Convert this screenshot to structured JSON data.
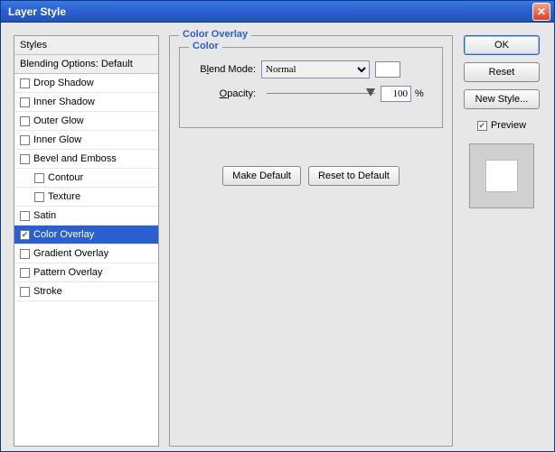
{
  "window": {
    "title": "Layer Style"
  },
  "sidebar": {
    "heading": "Styles",
    "blending": "Blending Options: Default",
    "items": [
      {
        "label": "Drop Shadow",
        "checked": false
      },
      {
        "label": "Inner Shadow",
        "checked": false
      },
      {
        "label": "Outer Glow",
        "checked": false
      },
      {
        "label": "Inner Glow",
        "checked": false
      },
      {
        "label": "Bevel and Emboss",
        "checked": false
      },
      {
        "label": "Contour",
        "checked": false,
        "sub": true
      },
      {
        "label": "Texture",
        "checked": false,
        "sub": true
      },
      {
        "label": "Satin",
        "checked": false
      },
      {
        "label": "Color Overlay",
        "checked": true,
        "active": true
      },
      {
        "label": "Gradient Overlay",
        "checked": false
      },
      {
        "label": "Pattern Overlay",
        "checked": false
      },
      {
        "label": "Stroke",
        "checked": false
      }
    ]
  },
  "panel": {
    "title": "Color Overlay",
    "subtitle": "Color",
    "blend_label_pre": "B",
    "blend_label_ul": "l",
    "blend_label_post": "end Mode:",
    "blend_value": "Normal",
    "opacity_label_pre": "",
    "opacity_label_ul": "O",
    "opacity_label_post": "pacity:",
    "opacity_value": "100",
    "opacity_unit": "%",
    "make_default": "Make Default",
    "reset_default": "Reset to Default"
  },
  "right": {
    "ok": "OK",
    "reset": "Reset",
    "new_style": "New Style...",
    "preview": "Preview"
  }
}
